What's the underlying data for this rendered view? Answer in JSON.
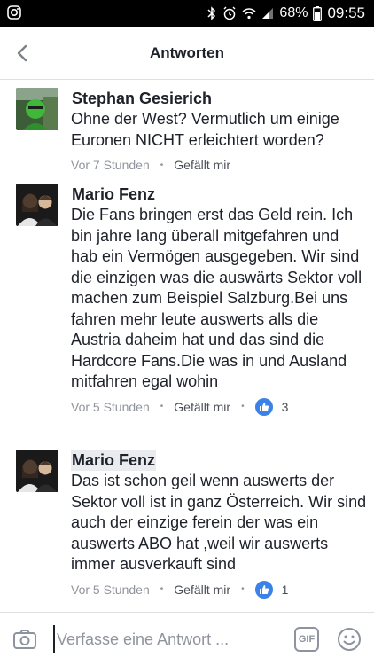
{
  "status_bar": {
    "battery": "68%",
    "time": "09:55"
  },
  "header": {
    "title": "Antworten"
  },
  "comments": [
    {
      "author": "Stephan Gesierich",
      "text": "Ohne der West? Vermutlich um einige Euronen NICHT erleichtert worden?",
      "time": "Vor 7 Stunden",
      "like_label": "Gefällt mir",
      "reaction_count": ""
    },
    {
      "author": "Mario Fenz",
      "text": "Die Fans bringen erst das Geld rein. Ich bin jahre lang überall mitgefahren und hab ein Vermögen ausgegeben. Wir sind die einzigen was die auswärts Sektor voll machen zum Beispiel Salzburg.Bei uns fahren mehr leute auswerts alls die Austria daheim hat und das sind die Hardcore Fans.Die was in und Ausland mitfahren egal wohin",
      "time": "Vor 5 Stunden",
      "like_label": "Gefällt mir",
      "reaction_count": "3"
    },
    {
      "author": "Mario Fenz",
      "text": "Das ist schon geil wenn auswerts der Sektor voll ist in ganz Österreich. Wir sind auch der einzige ferein der was ein auswerts ABO hat ,weil wir auswerts immer ausverkauft sind",
      "time": "Vor 5 Stunden",
      "like_label": "Gefällt mir",
      "reaction_count": "1"
    }
  ],
  "composer": {
    "placeholder": "Verfasse eine Antwort ...",
    "gif_label": "GIF"
  },
  "colors": {
    "accent": "#3b82e8",
    "meta": "#90949c"
  }
}
